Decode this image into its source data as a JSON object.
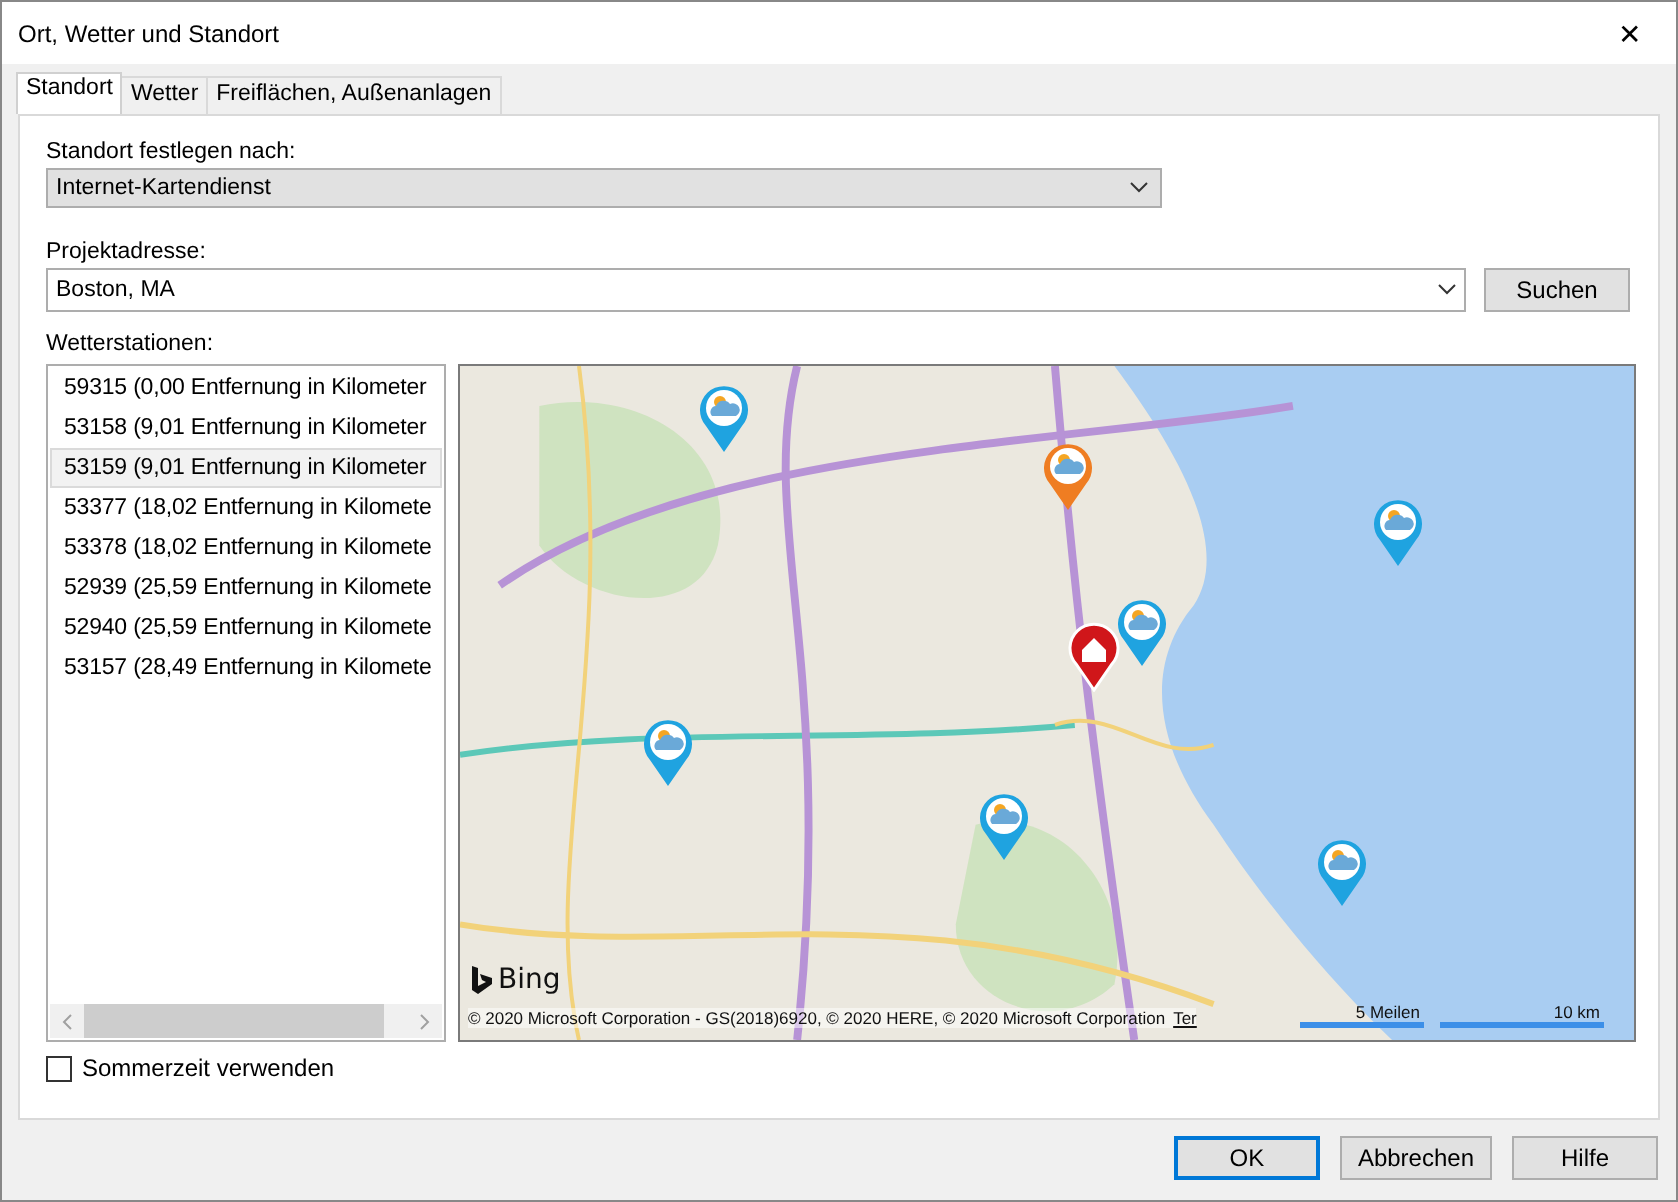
{
  "window": {
    "title": "Ort, Wetter und Standort",
    "close": "✕"
  },
  "tabs": [
    {
      "label": "Standort",
      "selected": true
    },
    {
      "label": "Wetter",
      "selected": false
    },
    {
      "label": "Freiflächen, Außenanlagen",
      "selected": false
    }
  ],
  "location_method": {
    "label": "Standort festlegen nach:",
    "value": "Internet-Kartendienst"
  },
  "project_address": {
    "label": "Projektadresse:",
    "value": "Boston, MA",
    "button": "Suchen"
  },
  "weather_stations": {
    "label": "Wetterstationen:",
    "items": [
      {
        "text": "59315 (0,00 Entfernung in Kilometer",
        "selected": false
      },
      {
        "text": "53158 (9,01 Entfernung in Kilometer",
        "selected": false
      },
      {
        "text": "53159 (9,01 Entfernung in Kilometer",
        "selected": true
      },
      {
        "text": "53377 (18,02 Entfernung in Kilomete",
        "selected": false
      },
      {
        "text": "53378 (18,02 Entfernung in Kilomete",
        "selected": false
      },
      {
        "text": "52939 (25,59 Entfernung in Kilomete",
        "selected": false
      },
      {
        "text": "52940 (25,59 Entfernung in Kilomete",
        "selected": false
      },
      {
        "text": "53157 (28,49 Entfernung in Kilomete",
        "selected": false
      }
    ]
  },
  "map": {
    "kind": "picture",
    "brand": "Bing",
    "attribution": "© 2020 Microsoft Corporation - GS(2018)6920, © 2020 HERE, © 2020 Microsoft Corporation",
    "terms": "Ter",
    "scale_miles": "5 Meilen",
    "scale_km": "10 km"
  },
  "daylight_saving": {
    "label": "Sommerzeit verwenden",
    "checked": false
  },
  "buttons": [
    {
      "label": "OK",
      "kind": "default"
    },
    {
      "label": "Abbrechen",
      "kind": "normal"
    },
    {
      "label": "Hilfe",
      "kind": "normal"
    }
  ]
}
